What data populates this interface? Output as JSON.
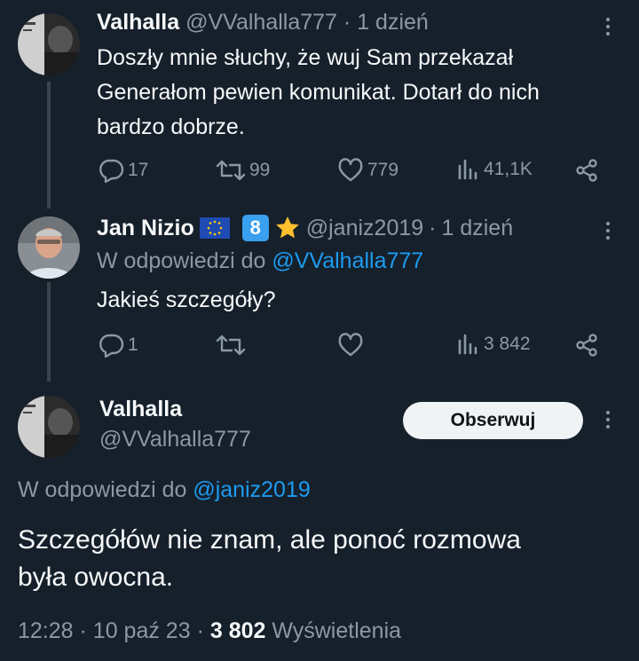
{
  "tweet1": {
    "display_name": "Valhalla",
    "handle": "@VValhalla777",
    "separator": "·",
    "time": "1 dzień",
    "text_line1": "Doszły mnie słuchy, że wuj Sam przekazał",
    "text_line2": "Generałom pewien komunikat. Dotarł do nich",
    "text_line3": "bardzo dobrze.",
    "replies": "17",
    "retweets": "99",
    "likes": "779",
    "views": "41,1K"
  },
  "tweet2": {
    "display_name": "Jan Nizio",
    "badge_number": "8",
    "handle": "@janiz2019",
    "separator": "·",
    "time": "1 dzień",
    "reply_prefix": "W odpowiedzi do",
    "reply_to": "@VValhalla777",
    "text": "Jakieś szczegóły?",
    "replies": "1",
    "retweets": "",
    "likes": "",
    "views": "3 842"
  },
  "tweet3": {
    "display_name": "Valhalla",
    "handle": "@VValhalla777",
    "follow_label": "Obserwuj",
    "reply_prefix": "W odpowiedzi do",
    "reply_to": "@janiz2019",
    "text_line1": "Szczegółów nie znam, ale ponoć rozmowa",
    "text_line2": "była owocna.",
    "time": "12:28",
    "sep1": "·",
    "date": "10 paź 23",
    "sep2": "·",
    "views_count": "3 802",
    "views_label": "Wyświetlenia"
  },
  "colors": {
    "background": "#15202b",
    "text": "#f7f9f9",
    "muted": "#8b98a5",
    "link": "#1d9bf0",
    "thread_line": "#38444d"
  }
}
